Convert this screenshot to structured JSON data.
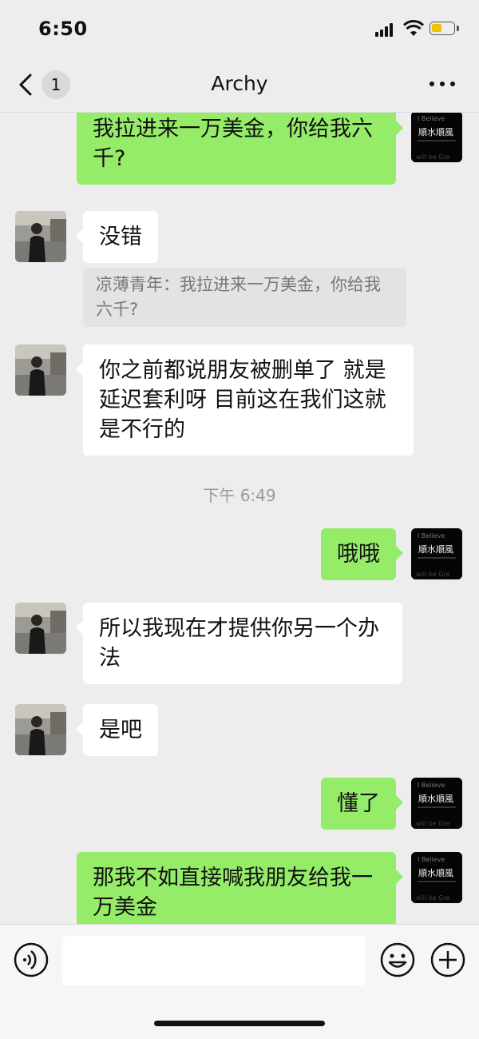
{
  "status_bar": {
    "time": "6:50"
  },
  "header": {
    "back_badge": "1",
    "title": "Archy"
  },
  "avatars": {
    "self_lines": [
      "I Believe",
      "順水順風",
      "will be Gre"
    ]
  },
  "messages": [
    {
      "id": "m1",
      "side": "out",
      "text": "我拉进来一万美金，你给我六千?"
    },
    {
      "id": "m2",
      "side": "in",
      "text": "没错",
      "quote": "凉薄青年：我拉进来一万美金，你给我六千?"
    },
    {
      "id": "m3",
      "side": "in",
      "text": "你之前都说朋友被删单了  就是延迟套利呀  目前这在我们这就是不行的"
    },
    {
      "id": "ts1",
      "type": "timestamp",
      "text": "下午 6:49"
    },
    {
      "id": "m4",
      "side": "out",
      "text": "哦哦"
    },
    {
      "id": "m5",
      "side": "in",
      "text": "所以我现在才提供你另一个办法"
    },
    {
      "id": "m6",
      "side": "in",
      "text": "是吧"
    },
    {
      "id": "m7",
      "side": "out",
      "text": "懂了"
    },
    {
      "id": "m8",
      "side": "out",
      "text": "那我不如直接喊我朋友给我一万美金"
    }
  ],
  "input_bar": {
    "placeholder": ""
  },
  "colors": {
    "background": "#ededed",
    "bubble_out": "#95ec69",
    "bubble_in": "#ffffff",
    "battery": "#f2c200"
  },
  "icons": [
    "back-chevron-icon",
    "more-icon",
    "voice-icon",
    "emoji-icon",
    "add-icon"
  ]
}
